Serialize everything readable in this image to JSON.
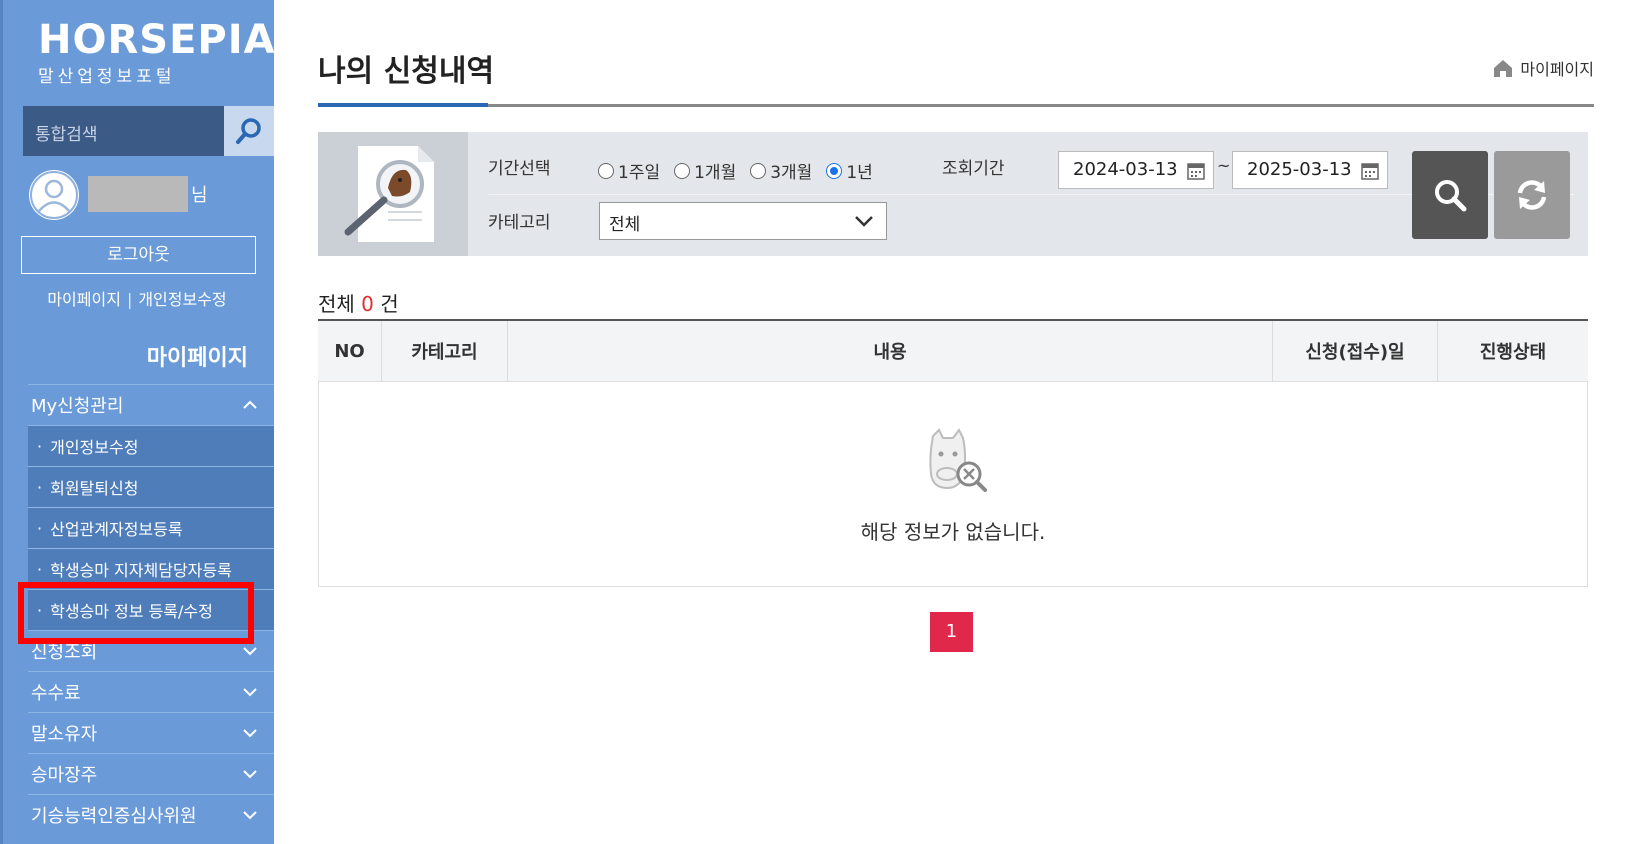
{
  "sidebar": {
    "logo_main": "HORSEPIA",
    "logo_sub": "말산업정보포털",
    "search_placeholder": "통합검색",
    "name_suffix": "님",
    "logout_label": "로그아웃",
    "link_mypage": "마이페이지",
    "link_separator": "|",
    "link_edit_info": "개인정보수정",
    "section_title": "마이페이지",
    "menu_top": {
      "label": "My신청관리",
      "expanded": true
    },
    "sub_items": [
      {
        "label": "개인정보수정"
      },
      {
        "label": "회원탈퇴신청"
      },
      {
        "label": "산업관계자정보등록"
      },
      {
        "label": "학생승마 지자체담당자등록"
      },
      {
        "label": "학생승마 정보 등록/수정"
      }
    ],
    "menu_bottom": [
      {
        "label": "신청조회"
      },
      {
        "label": "수수료"
      },
      {
        "label": "말소유자"
      },
      {
        "label": "승마장주"
      },
      {
        "label": "기승능력인증심사위원"
      }
    ],
    "highlight_color": "#ff0000"
  },
  "main": {
    "title": "나의 신청내역",
    "breadcrumb": "마이페이지",
    "filter": {
      "period_label": "기간선택",
      "radio_options": [
        "1주일",
        "1개월",
        "3개월",
        "1년"
      ],
      "selected_option": "1년",
      "range_label": "조회기간",
      "date_from": "2024-03-13",
      "date_to": "2025-03-13",
      "tilde": "~",
      "category_label": "카테고리",
      "category_value": "전체"
    },
    "count_prefix": "전체",
    "count_value": "0",
    "count_suffix": "건",
    "table": {
      "headers": [
        "NO",
        "카테고리",
        "내용",
        "신청(접수)일",
        "진행상태"
      ],
      "empty_message": "해당 정보가 없습니다."
    },
    "pagination": {
      "current": "1"
    }
  },
  "colors": {
    "sidebar_bg": "#6a9bd8",
    "accent": "#2a67b5",
    "count_highlight": "#e03030",
    "pager_active": "#e0284a"
  }
}
